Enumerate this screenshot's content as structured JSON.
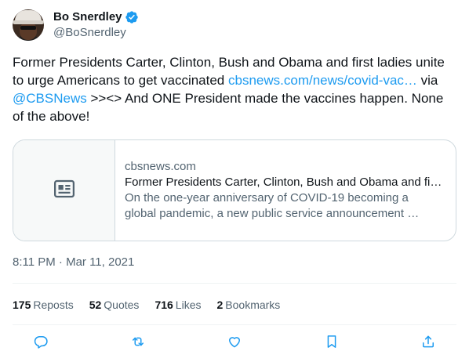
{
  "author": {
    "display_name": "Bo Snerdley",
    "handle": "@BoSnerdley",
    "verified_icon": "verified-badge-icon",
    "verified_color": "#1d9bf0"
  },
  "tweet": {
    "text_part1": "Former Presidents Carter, Clinton, Bush and Obama and first ladies unite to urge Americans to get vaccinated ",
    "link": "cbsnews.com/news/covid-vac…",
    "text_part2": " via ",
    "mention": "@CBSNews",
    "text_part3": " >><> And ONE President made the vaccines happen. None of the above!"
  },
  "card": {
    "media_icon": "news-article-icon",
    "domain": "cbsnews.com",
    "title": "Former Presidents Carter, Clinton, Bush and Obama and fi…",
    "description_line1": "On the one-year anniversary of COVID-19 becoming a",
    "description_line2": "global pandemic, a new public service announcement …"
  },
  "timestamp": "8:11 PM · Mar 11, 2021",
  "stats": {
    "reposts_count": "175",
    "reposts_label": "Reposts",
    "quotes_count": "52",
    "quotes_label": "Quotes",
    "likes_count": "716",
    "likes_label": "Likes",
    "bookmarks_count": "2",
    "bookmarks_label": "Bookmarks"
  },
  "actions": [
    "reply-icon",
    "repost-icon",
    "like-icon",
    "bookmark-icon",
    "share-icon"
  ],
  "colors": {
    "link": "#1d9bf0",
    "secondary_text": "#536471",
    "primary_text": "#0f1419",
    "border": "#cfd9de"
  }
}
